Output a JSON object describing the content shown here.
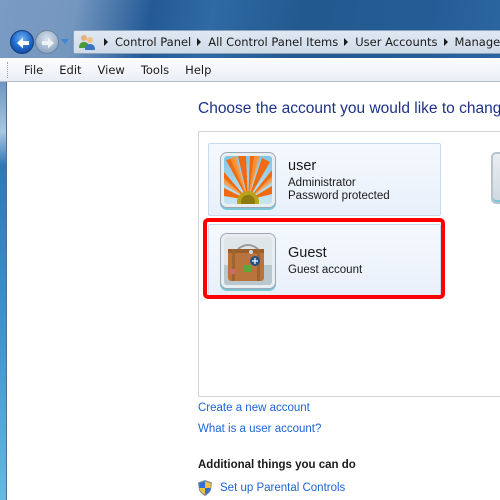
{
  "window": {
    "address_bar": {
      "breadcrumbs": [
        "Control Panel",
        "All Control Panel Items",
        "User Accounts",
        "Manage Accounts"
      ],
      "location_icon": "user-accounts-icon"
    },
    "nav": {
      "back_icon": "back-arrow-icon",
      "forward_icon": "forward-arrow-icon",
      "recent_icon": "chevron-down-icon"
    }
  },
  "menubar": {
    "items": [
      "File",
      "Edit",
      "View",
      "Tools",
      "Help"
    ]
  },
  "main": {
    "title": "Choose the account you would like to change",
    "accounts": [
      {
        "name": "user",
        "details": [
          "Administrator",
          "Password protected"
        ],
        "picture": "orange-flower-picture"
      },
      {
        "name": "Guest",
        "details": [
          "Guest account"
        ],
        "picture": "suitcase-picture",
        "highlighted": true
      }
    ],
    "links": {
      "create": "Create a new account",
      "what_is": "What is a user account?"
    },
    "additional": {
      "heading": "Additional things you can do",
      "items": [
        {
          "label": "Set up Parental Controls",
          "icon": "uac-shield-icon"
        }
      ]
    }
  },
  "colors": {
    "title_text": "#1e3287",
    "link_text": "#1e63d6",
    "highlight_border": "#ff0000"
  }
}
